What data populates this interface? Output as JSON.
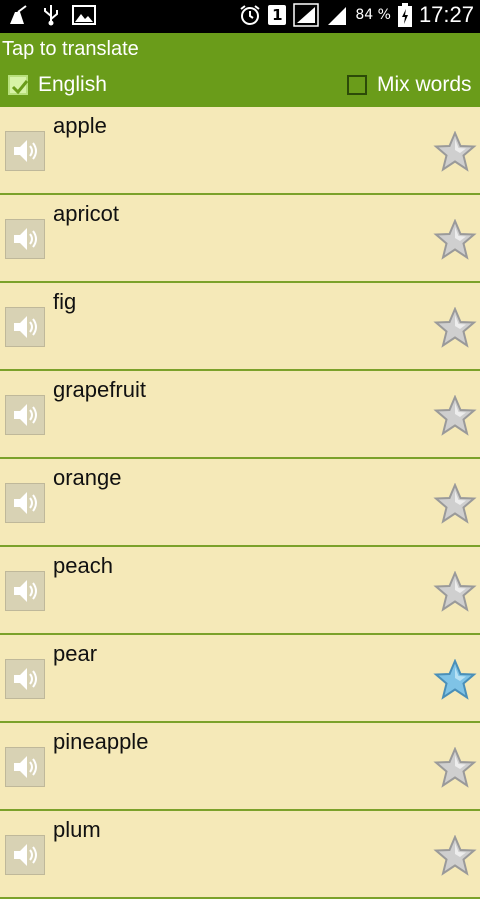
{
  "status_bar": {
    "battery_percent": "84 %",
    "time": "17:27",
    "sim_slot": "1",
    "icons": [
      "cleaner-icon",
      "usb-icon",
      "image-icon",
      "alarm-icon",
      "sim-icon",
      "signal-icon",
      "signal-icon",
      "battery-charging-icon"
    ]
  },
  "header": {
    "title": "Tap to translate",
    "english_label": "English",
    "english_checked": true,
    "mix_label": "Mix words",
    "mix_checked": false,
    "color": "#6a9c1a"
  },
  "list": {
    "items": [
      {
        "word": "apple",
        "favorite": false
      },
      {
        "word": "apricot",
        "favorite": false
      },
      {
        "word": "fig",
        "favorite": false
      },
      {
        "word": "grapefruit",
        "favorite": false
      },
      {
        "word": "orange",
        "favorite": false
      },
      {
        "word": "peach",
        "favorite": false
      },
      {
        "word": "pear",
        "favorite": true
      },
      {
        "word": "pineapple",
        "favorite": false
      },
      {
        "word": "plum",
        "favorite": false
      }
    ],
    "background": "#f5e9b8",
    "divider_color": "#7ba12a"
  }
}
